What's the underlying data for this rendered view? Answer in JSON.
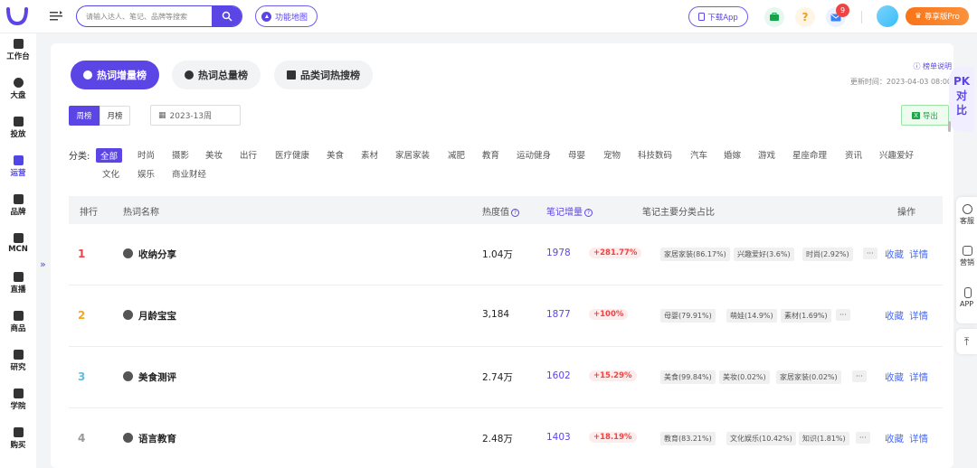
{
  "topbar": {
    "search_placeholder": "请输入达人、笔记、品牌等搜索",
    "function_map": "功能地图",
    "download_app": "下载App",
    "notification_count": "9",
    "pro_label": "尊享版Pro"
  },
  "sidebar": {
    "items": [
      {
        "label": "工作台"
      },
      {
        "label": "大盘"
      },
      {
        "label": "投放"
      },
      {
        "label": "运营"
      },
      {
        "label": "品牌"
      },
      {
        "label": "MCN"
      },
      {
        "label": "直播"
      },
      {
        "label": "商品"
      },
      {
        "label": "研究"
      },
      {
        "label": "学院"
      },
      {
        "label": "购买"
      }
    ],
    "active_index": 3
  },
  "tabs": [
    {
      "label": "热词增量榜",
      "active": true
    },
    {
      "label": "热词总量榜",
      "active": false
    },
    {
      "label": "品类词热搜榜",
      "active": false
    }
  ],
  "header": {
    "rank_description": "榜单说明",
    "update_time": "更新时间：2023-04-03 08:00"
  },
  "period": {
    "week": "周榜",
    "month": "月榜",
    "selected": "week"
  },
  "date_picker": {
    "value": "2023-13周"
  },
  "export_label": "导出",
  "categories": {
    "label": "分类:",
    "items": [
      "全部",
      "时尚",
      "摄影",
      "美妆",
      "出行",
      "医疗健康",
      "美食",
      "素材",
      "家居家装",
      "减肥",
      "教育",
      "运动健身",
      "母婴",
      "宠物",
      "科技数码",
      "汽车",
      "婚嫁",
      "游戏",
      "星座命理",
      "资讯",
      "兴趣爱好",
      "文化",
      "娱乐",
      "商业财经"
    ],
    "active": "全部"
  },
  "table": {
    "headers": {
      "rank": "排行",
      "name": "热词名称",
      "heat": "热度值",
      "increase": "笔记增量",
      "share": "笔记主要分类占比",
      "ops": "操作"
    },
    "rows": [
      {
        "rank": "1",
        "rank_color": "#ef4444",
        "name": "收纳分享",
        "heat": "1.04万",
        "increase": "1978",
        "pct": "+281.77%",
        "shares": [
          "家居家装(86.17%)",
          "兴趣爱好(3.6%)",
          "时尚(2.92%)"
        ],
        "more": "···",
        "collect": "收藏",
        "detail": "详情"
      },
      {
        "rank": "2",
        "rank_color": "#f5a623",
        "name": "月龄宝宝",
        "heat": "3,184",
        "increase": "1877",
        "pct": "+100%",
        "shares": [
          "母婴(79.91%)",
          "萌娃(14.9%)",
          "素材(1.69%)"
        ],
        "more": "···",
        "collect": "收藏",
        "detail": "详情"
      },
      {
        "rank": "3",
        "rank_color": "#5bc0de",
        "name": "美食测评",
        "heat": "2.74万",
        "increase": "1602",
        "pct": "+15.29%",
        "shares": [
          "美食(99.84%)",
          "美妆(0.02%)",
          "家居家装(0.02%)"
        ],
        "more": "···",
        "collect": "收藏",
        "detail": "详情"
      },
      {
        "rank": "4",
        "rank_color": "#999999",
        "name": "语言教育",
        "heat": "2.48万",
        "increase": "1403",
        "pct": "+18.19%",
        "shares": [
          "教育(83.21%)",
          "文化娱乐(10.42%)",
          "知识(1.81%)"
        ],
        "more": "···",
        "collect": "收藏",
        "detail": "详情"
      }
    ]
  },
  "floating": {
    "pk_line1": "PK",
    "pk_line2": "对",
    "pk_line3": "比",
    "service": "客服",
    "marketing": "营销",
    "app": "APP"
  }
}
